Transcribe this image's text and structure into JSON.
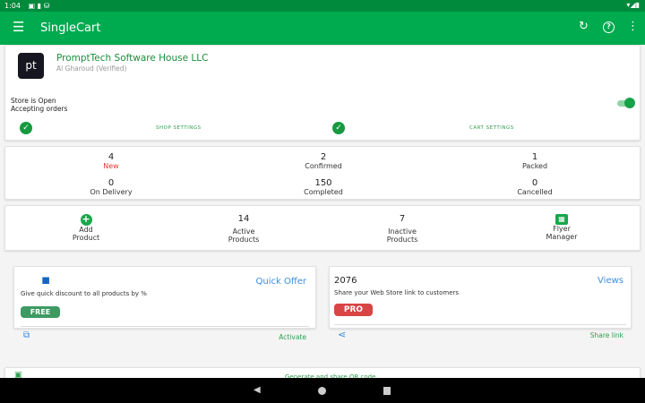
{
  "status_bar": {
    "time": "1:04"
  },
  "app_bar": {
    "title": "SingleCart"
  },
  "store": {
    "logo_text": "pt",
    "name": "PromptTech Software House LLC",
    "subtitle": "Al Gharoud (Verified)",
    "status_line1": "Store is Open",
    "status_line2": "Accepting orders",
    "toggle_on": true,
    "shop_settings": "SHOP SETTINGS",
    "cart_settings": "CART SETTINGS"
  },
  "orders": [
    {
      "count": "4",
      "label": "New"
    },
    {
      "count": "2",
      "label": "Confirmed"
    },
    {
      "count": "1",
      "label": "Packed"
    },
    {
      "count": "0",
      "label": "On Delivery"
    },
    {
      "count": "150",
      "label": "Completed"
    },
    {
      "count": "0",
      "label": "Cancelled"
    }
  ],
  "products": {
    "add_line1": "Add",
    "add_line2": "Product",
    "active_count": "14",
    "active_line1": "Active",
    "active_line2": "Products",
    "inactive_count": "7",
    "inactive_line1": "Inactive",
    "inactive_line2": "Products",
    "flyer_line1": "Flyer",
    "flyer_line2": "Manager"
  },
  "quick_offer": {
    "title": "Quick Offer",
    "description": "Give quick discount to all products by %",
    "badge": "FREE",
    "action": "Activate"
  },
  "web_store": {
    "views_count": "2076",
    "views_label": "Views",
    "description": "Share your Web Store link to customers",
    "badge": "PRO",
    "action": "Share link"
  },
  "qr": {
    "label": "Generate and share QR code"
  },
  "colors": {
    "primary": "#00aa4f",
    "status_bar": "#008a3c",
    "new_red": "#e53935",
    "free_badge": "#3e9a62",
    "pro_badge": "#d94444",
    "link_blue": "#3b8de0"
  }
}
